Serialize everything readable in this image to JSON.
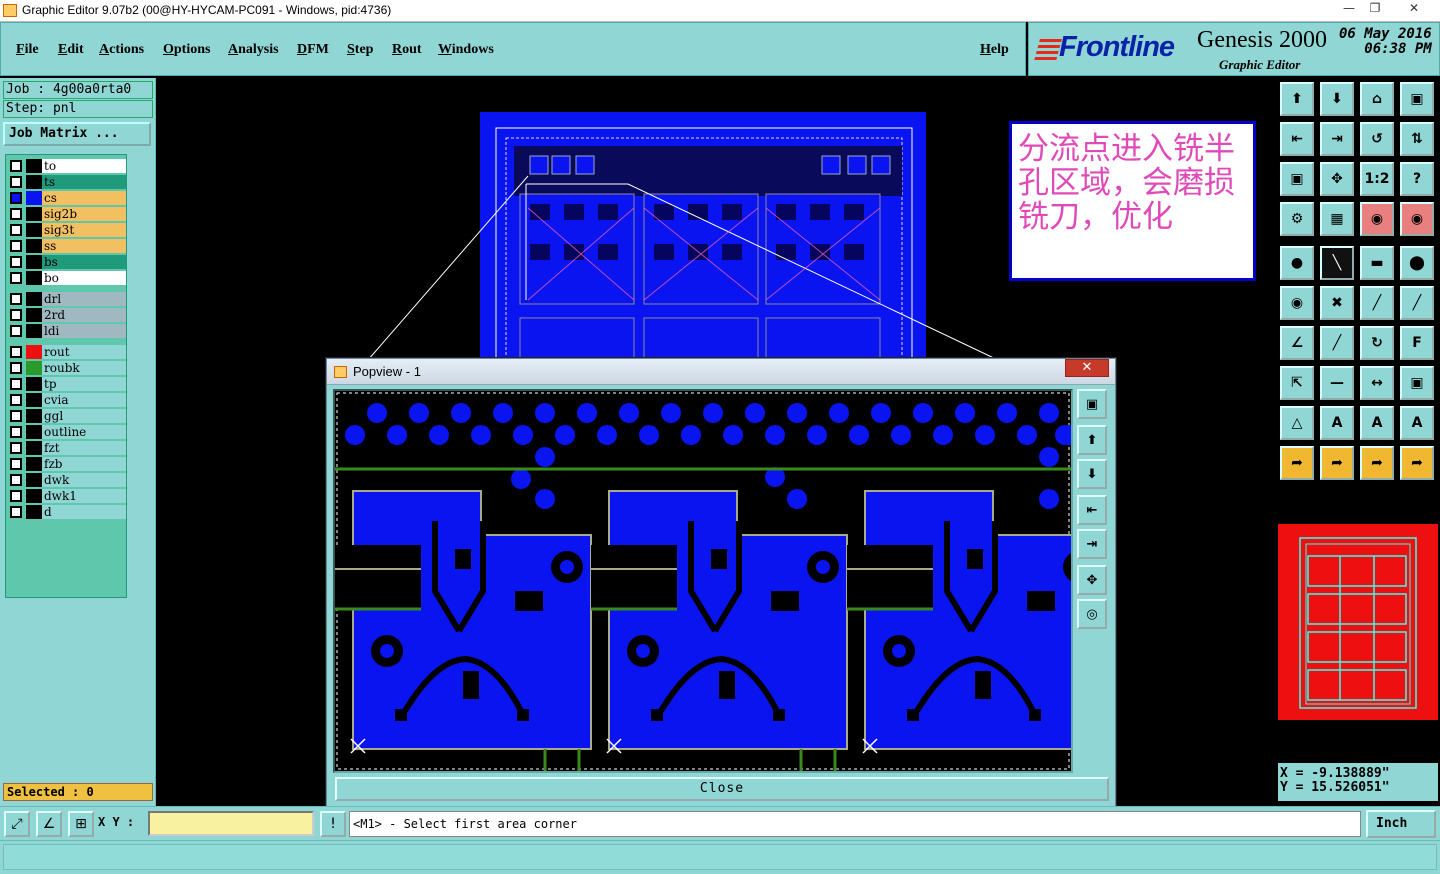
{
  "window": {
    "title": "Graphic Editor 9.07b2 (00@HY-HYCAM-PC091 - Windows, pid:4736)"
  },
  "menu": [
    "File",
    "Edit",
    "Actions",
    "Options",
    "Analysis",
    "DFM",
    "Step",
    "Rout",
    "Windows",
    "Help"
  ],
  "logo": {
    "brand": "Frontline",
    "product": "Genesis 2000",
    "subtitle": "Graphic Editor",
    "date": "06 May 2016",
    "time": "06:38 PM"
  },
  "job": {
    "job_line": "Job : 4g00a0rta0",
    "step_line": "Step: pnl",
    "matrix_button": "Job Matrix ..."
  },
  "layers": [
    {
      "name": "to",
      "color": "#ffffff",
      "sel": ""
    },
    {
      "name": "ts",
      "color": "#1f9a7a",
      "sel": ""
    },
    {
      "name": "cs",
      "color": "#f2c060",
      "sel": "blue"
    },
    {
      "name": "sig2b",
      "color": "#f2c060",
      "sel": ""
    },
    {
      "name": "sig3t",
      "color": "#f2c060",
      "sel": ""
    },
    {
      "name": "ss",
      "color": "#f2c060",
      "sel": ""
    },
    {
      "name": "bs",
      "color": "#1f9a7a",
      "sel": ""
    },
    {
      "name": "bo",
      "color": "#ffffff",
      "sel": ""
    },
    {
      "name": "drl",
      "color": "#a0b8c0",
      "sel": ""
    },
    {
      "name": "2rd",
      "color": "#a0b8c0",
      "sel": ""
    },
    {
      "name": "ldi",
      "color": "#a0b8c0",
      "sel": ""
    },
    {
      "name": "rout",
      "color": "#8fd6d4",
      "sel": "red"
    },
    {
      "name": "roubk",
      "color": "#8fd6d4",
      "sel": "green"
    },
    {
      "name": "tp",
      "color": "#8fd6d4",
      "sel": ""
    },
    {
      "name": "cvia",
      "color": "#8fd6d4",
      "sel": ""
    },
    {
      "name": "ggl",
      "color": "#8fd6d4",
      "sel": ""
    },
    {
      "name": "outline",
      "color": "#8fd6d4",
      "sel": ""
    },
    {
      "name": "fzt",
      "color": "#8fd6d4",
      "sel": ""
    },
    {
      "name": "fzb",
      "color": "#8fd6d4",
      "sel": ""
    },
    {
      "name": "dwk",
      "color": "#8fd6d4",
      "sel": ""
    },
    {
      "name": "dwk1",
      "color": "#8fd6d4",
      "sel": ""
    },
    {
      "name": "d",
      "color": "#8fd6d4",
      "sel": ""
    }
  ],
  "selected_text": "Selected : 0",
  "note": "分流点进入铣半孔区域，会磨损铣刀，优化",
  "popup": {
    "title": "Popview - 1",
    "close_label": "Close"
  },
  "coords": {
    "x": "X = -9.138889\"",
    "y": "Y = 15.526051\""
  },
  "status": {
    "xy_label": "X Y :",
    "prompt": "<M1> - Select first area corner",
    "units": "Inch"
  },
  "colors": {
    "panel": "#8fd6d4",
    "copper": "#0a14f0",
    "rout": "#ee1010"
  }
}
